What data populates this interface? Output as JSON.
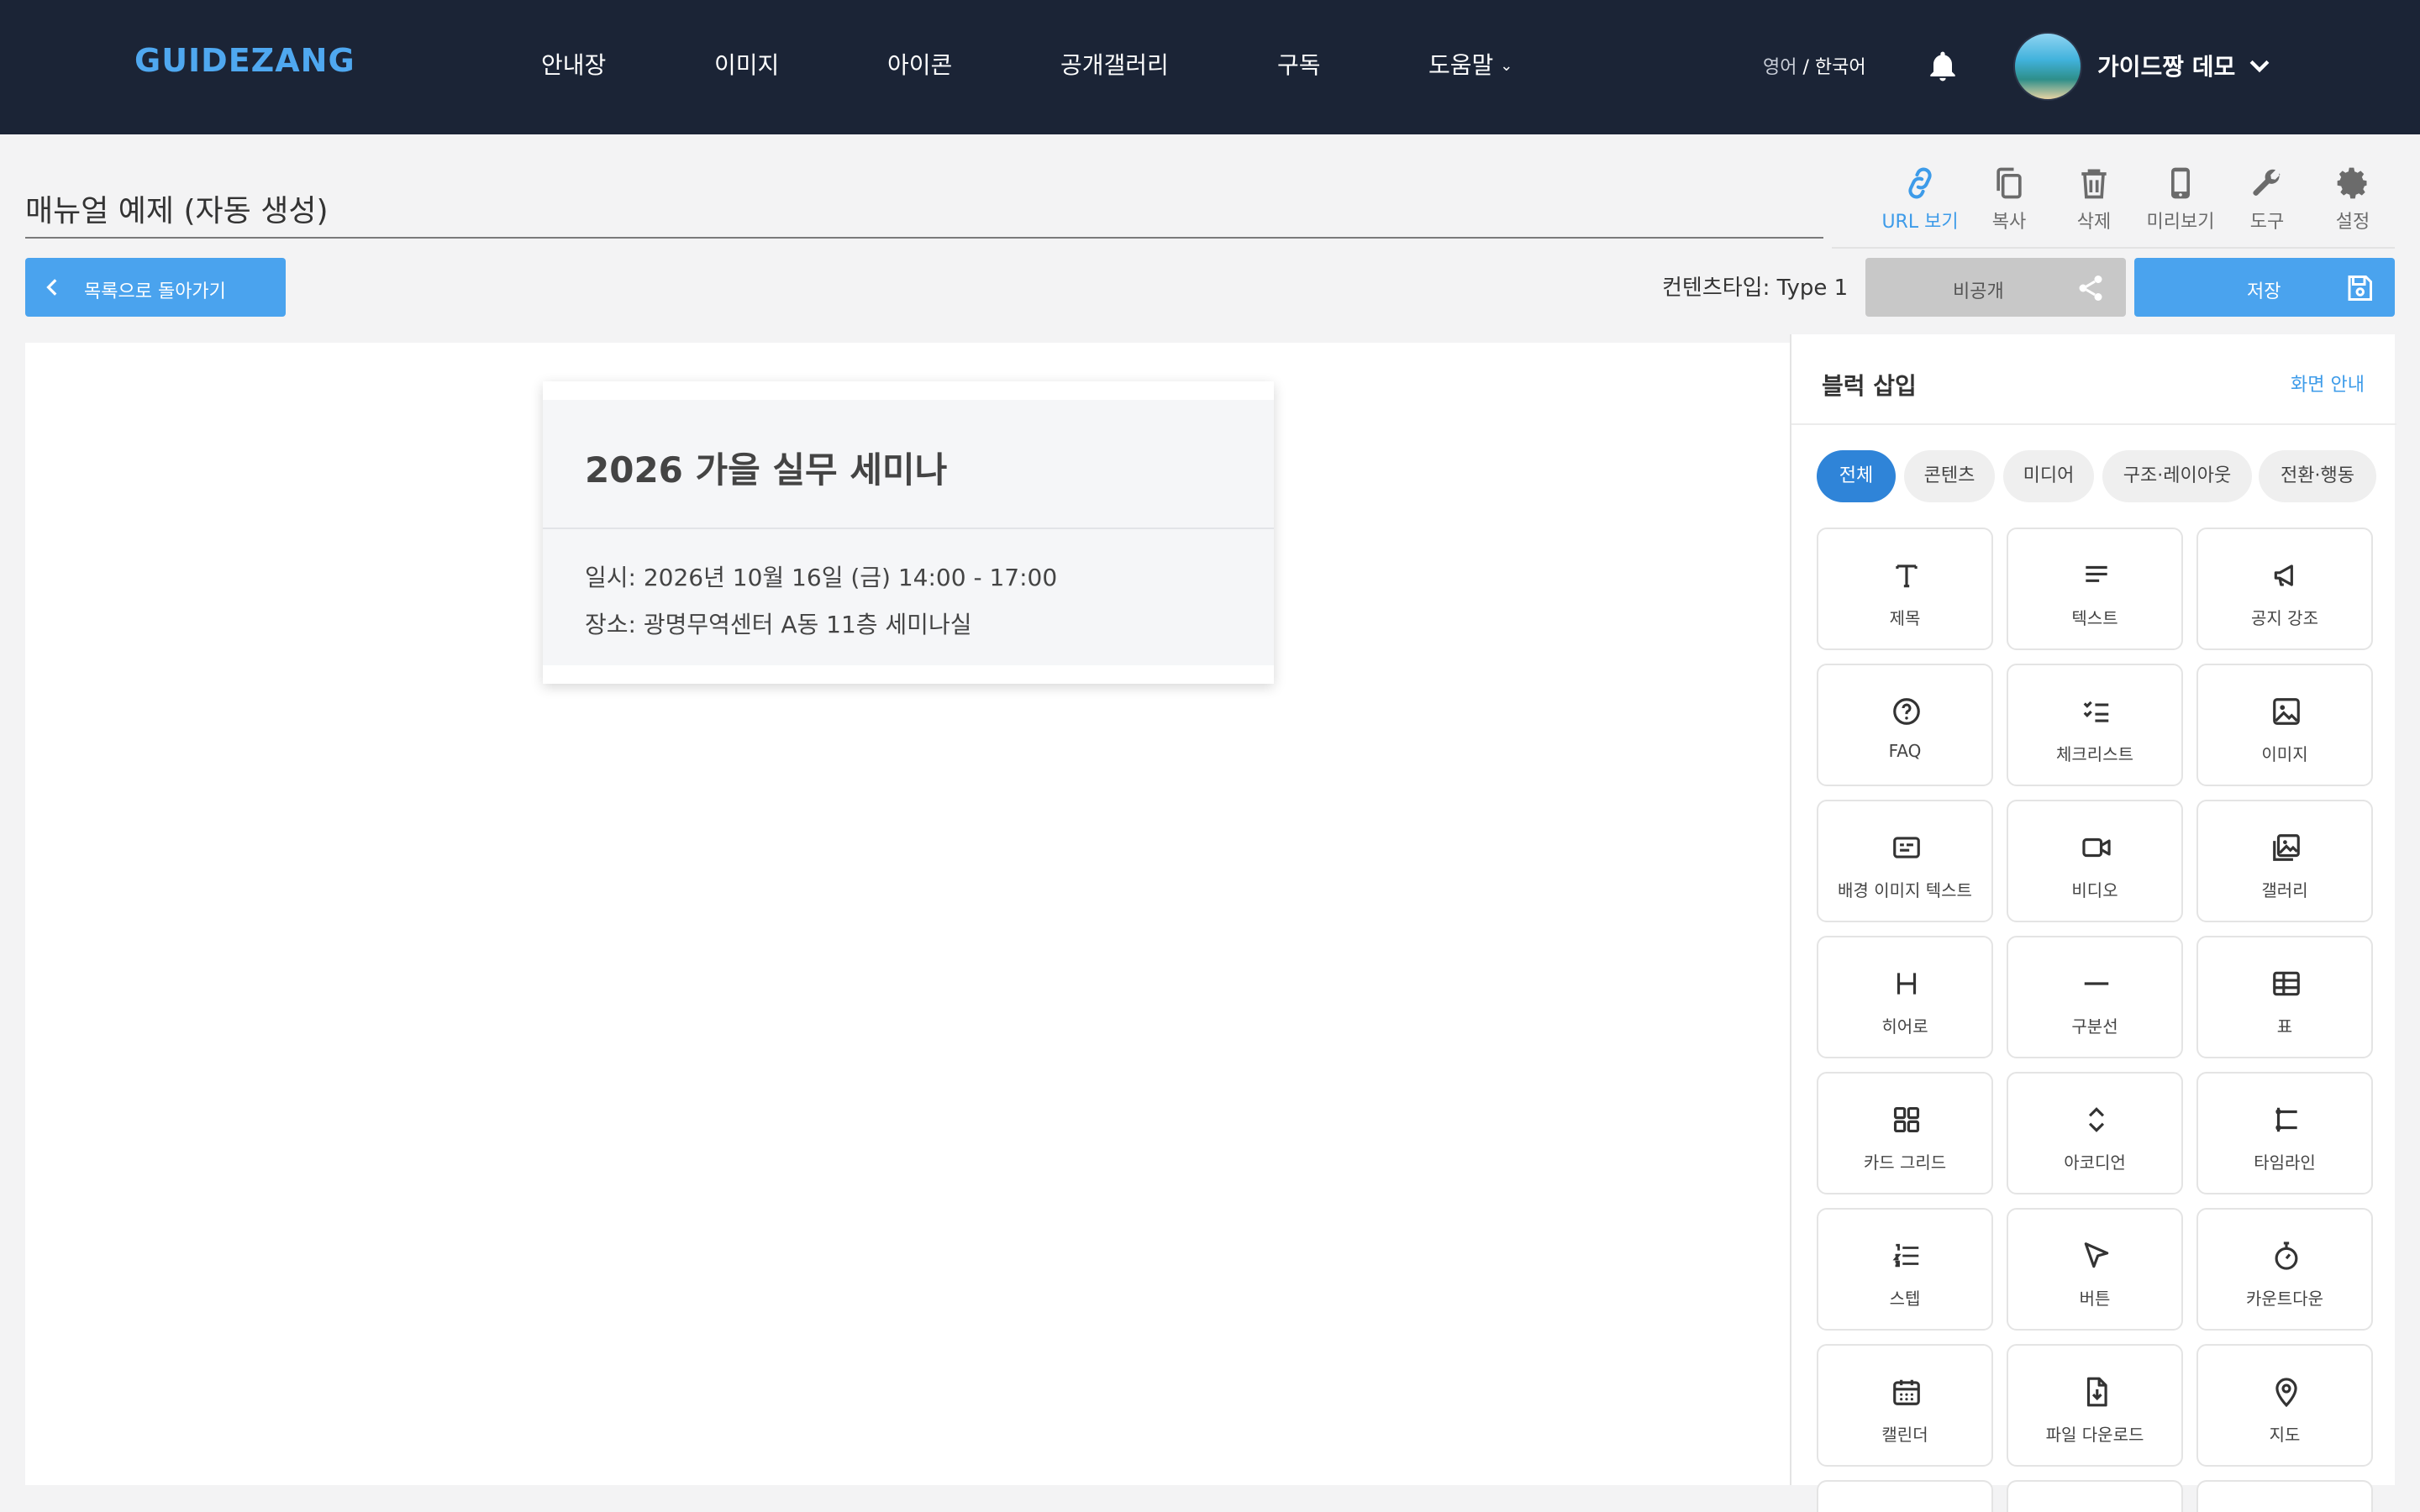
{
  "brand": "GUIDEZANG",
  "nav": [
    {
      "label": "안내장"
    },
    {
      "label": "이미지"
    },
    {
      "label": "아이콘"
    },
    {
      "label": "공개갤러리"
    },
    {
      "label": "구독"
    },
    {
      "label": "도움말"
    }
  ],
  "language": {
    "inactive": "영어",
    "divider": " / ",
    "active": "한국어"
  },
  "user": {
    "name": "가이드짱 데모"
  },
  "document": {
    "title": "매뉴얼 예제 (자동 생성)"
  },
  "toolbar": [
    {
      "label": "URL 보기",
      "icon": "link-icon",
      "active": true
    },
    {
      "label": "복사",
      "icon": "copy-icon"
    },
    {
      "label": "삭제",
      "icon": "trash-icon"
    },
    {
      "label": "미리보기",
      "icon": "phone-icon"
    },
    {
      "label": "도구",
      "icon": "wrench-icon"
    },
    {
      "label": "설정",
      "icon": "gear-icon"
    }
  ],
  "actions": {
    "back_label": "목록으로 돌아가기",
    "content_type": "컨텐츠타입: Type 1",
    "private_label": "비공개",
    "save_label": "저장"
  },
  "card": {
    "title": "2026 가을 실무 세미나",
    "lines": [
      "일시: 2026년 10월 16일 (금) 14:00 - 17:00",
      "장소: 광명무역센터 A동 11층 세미나실"
    ]
  },
  "panel": {
    "title": "블럭 삽입",
    "guide_link": "화면 안내",
    "tabs": [
      {
        "label": "전체",
        "active": true
      },
      {
        "label": "콘텐츠"
      },
      {
        "label": "미디어"
      },
      {
        "label": "구조·레이아웃"
      },
      {
        "label": "전환·행동"
      }
    ],
    "blocks": [
      {
        "label": "제목",
        "icon": "title-icon"
      },
      {
        "label": "텍스트",
        "icon": "text-icon"
      },
      {
        "label": "공지 강조",
        "icon": "megaphone-icon"
      },
      {
        "label": "FAQ",
        "icon": "question-icon"
      },
      {
        "label": "체크리스트",
        "icon": "checklist-icon"
      },
      {
        "label": "이미지",
        "icon": "image-icon"
      },
      {
        "label": "배경 이미지 텍스트",
        "icon": "bg-text-icon"
      },
      {
        "label": "비디오",
        "icon": "video-icon"
      },
      {
        "label": "갤러리",
        "icon": "gallery-icon"
      },
      {
        "label": "히어로",
        "icon": "hero-icon"
      },
      {
        "label": "구분선",
        "icon": "divider-icon"
      },
      {
        "label": "표",
        "icon": "table-icon"
      },
      {
        "label": "카드 그리드",
        "icon": "grid-icon"
      },
      {
        "label": "아코디언",
        "icon": "accordion-icon"
      },
      {
        "label": "타임라인",
        "icon": "timeline-icon"
      },
      {
        "label": "스텝",
        "icon": "steps-icon"
      },
      {
        "label": "버튼",
        "icon": "cursor-icon"
      },
      {
        "label": "카운트다운",
        "icon": "stopwatch-icon"
      },
      {
        "label": "캘린더",
        "icon": "calendar-icon"
      },
      {
        "label": "파일 다운로드",
        "icon": "file-download-icon"
      },
      {
        "label": "지도",
        "icon": "map-pin-icon"
      }
    ]
  },
  "colors": {
    "nav_bg": "#1b2436",
    "brand": "#4fa8f0",
    "accent": "#4aa3ee",
    "tab_active": "#2f84d8"
  }
}
